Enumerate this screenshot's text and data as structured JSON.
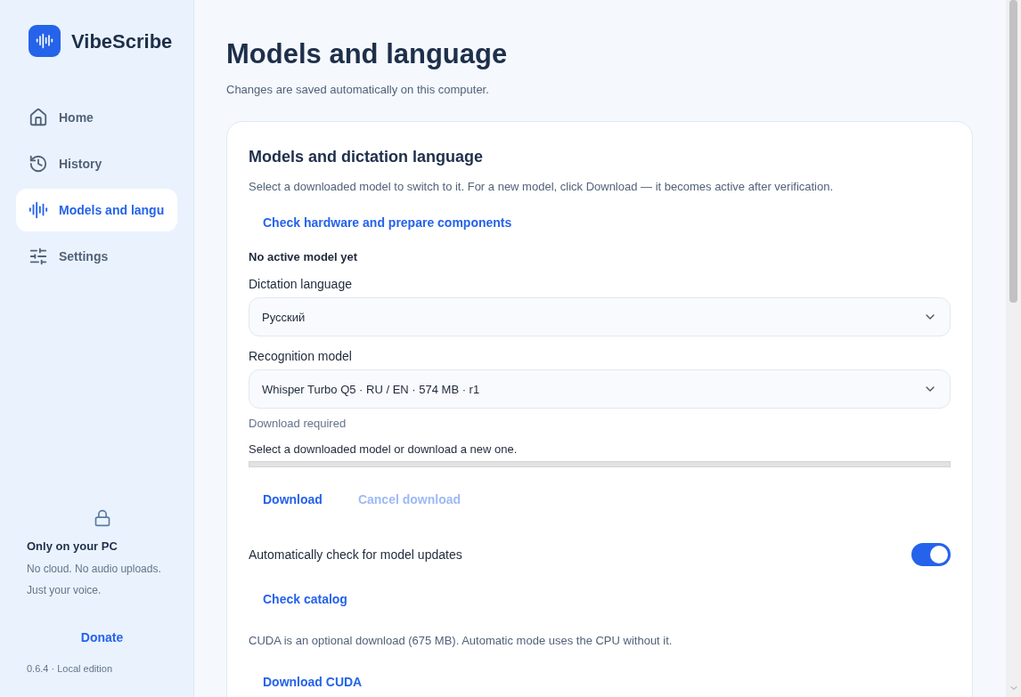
{
  "brand": {
    "name": "VibeScribe"
  },
  "nav": [
    {
      "label": "Home",
      "selected": false
    },
    {
      "label": "History",
      "selected": false
    },
    {
      "label": "Models and langu",
      "selected": true
    },
    {
      "label": "Settings",
      "selected": false
    }
  ],
  "privacy": {
    "title": "Only on your PC",
    "text": "No cloud. No audio uploads.",
    "text2": "Just your voice."
  },
  "donate": "Donate",
  "version": "0.6.4 · Local edition",
  "page": {
    "title": "Models and language",
    "subtitle": "Changes are saved automatically on this computer."
  },
  "card": {
    "title": "Models and dictation language",
    "description": "Select a downloaded model to switch to it. For a new model, click Download — it becomes active after verification.",
    "check_hardware": "Check hardware and prepare components",
    "active_model": "No active model yet",
    "language_label": "Dictation language",
    "language_value": "Русский",
    "model_label": "Recognition model",
    "model_value": "Whisper Turbo Q5 · RU / EN · 574 MB · r1",
    "status": "Download required",
    "hint": "Select a downloaded model or download a new one.",
    "progress": {
      "level": 0
    },
    "download": {
      "label": "Download",
      "disabled": false
    },
    "cancel": {
      "label": "Cancel download",
      "disabled": true
    },
    "auto_update": {
      "label": "Automatically check for model updates",
      "on": true
    },
    "check_catalog": "Check catalog",
    "cuda_note": "CUDA is an optional download (675 MB). Automatic mode uses the CPU without it.",
    "download_cuda": "Download CUDA"
  }
}
